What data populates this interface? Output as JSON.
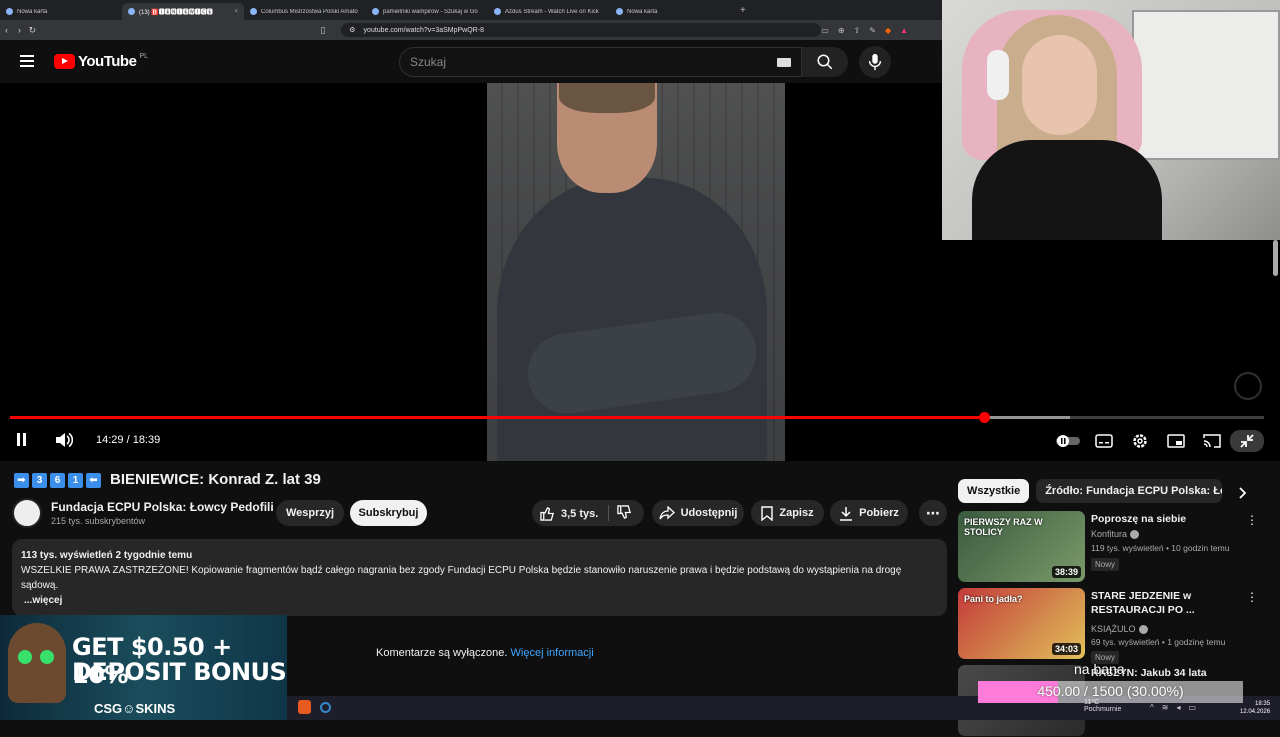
{
  "browser": {
    "tabs": [
      {
        "label": "Nowa karta",
        "active": false
      },
      {
        "label": "(13) 🅱️🅸🅴🅽🅸🅴🆆🅸🅲🅴",
        "active": true
      },
      {
        "label": "Columbus Mistrzostwa Polski Amato",
        "active": false
      },
      {
        "label": "pamietniki wampirow - Szukaj w Go",
        "active": false
      },
      {
        "label": "Azdus Stream - Watch Live on Kick",
        "active": false
      },
      {
        "label": "Nowa karta",
        "active": false
      }
    ],
    "url": "youtube.com/watch?v=3aSMpPwQR-8"
  },
  "header": {
    "logo": "YouTube",
    "region": "PL",
    "search_placeholder": "Szukaj"
  },
  "player": {
    "current_time": "14:29",
    "duration": "18:39",
    "time_display": "14:29 / 18:39",
    "progress_fraction": 0.7766,
    "buffered_fraction": 0.845
  },
  "video": {
    "title_icons": [
      "➡",
      "3",
      "6",
      "1",
      "⬅"
    ],
    "title": "BIENIEWICE: Konrad Z. lat 39",
    "channel": "Fundacja ECPU Polska: Łowcy Pedofili",
    "subscribers": "215 tys. subskrybentów",
    "join_label": "Wesprzyj",
    "subscribe_label": "Subskrybuj",
    "likes": "3,5 tys.",
    "share_label": "Udostępnij",
    "save_label": "Zapisz",
    "download_label": "Pobierz"
  },
  "description": {
    "meta": "113 tys. wyświetleń  2 tygodnie temu",
    "text": "WSZELKIE PRAWA ZASTRZEŻONE! Kopiowanie fragmentów bądź całego nagrania bez zgody Fundacji ECPU Polska będzie stanowiło naruszenie prawa i będzie podstawą do wystąpienia na drogę sądową.",
    "more": "...więcej"
  },
  "comments": {
    "disabled_text": "Komentarze są wyłączone.",
    "link": "Więcej informacji"
  },
  "sidebar": {
    "chips": [
      "Wszystkie",
      "Źródło: Fundacja ECPU Polska: Łowcy"
    ],
    "recommendations": [
      {
        "title": "Poproszę na siebie",
        "channel": "Konfitura",
        "stats": "119 tys. wyświetleń • 10 godzin temu",
        "badge": "Nowy",
        "duration": "38:39",
        "thumb_text": "PIERWSZY RAZ W STOLICY",
        "colors": [
          "#3a5a3e",
          "#7a9a6a"
        ]
      },
      {
        "title": "STARE JEDZENIE w RESTAURACJI PO ...",
        "channel": "KSIĄŻULO",
        "stats": "69 tys. wyświetleń • 1 godzinę temu",
        "badge": "Nowy",
        "duration": "34:03",
        "thumb_text": "Pani to jadła?",
        "colors": [
          "#c43a3a",
          "#e0c15a"
        ]
      },
      {
        "title": "RASZYN: Jakub 34 lata",
        "channel": "",
        "stats": "",
        "badge": "",
        "duration": "",
        "thumb_text": "",
        "colors": [
          "#4a4a4a",
          "#2a2a2a"
        ]
      }
    ]
  },
  "ad": {
    "line1": "GET $0.50 + 10%",
    "line2": "DEPOSIT BONUS",
    "brand": "CSG☺SKINS"
  },
  "taskbar": {
    "weather_temp": "11°C",
    "weather_desc": "Pochmurnie",
    "time": "18:35",
    "date": "12.04.2026"
  },
  "goal": {
    "label": "na bana",
    "current": 450,
    "target": 1500,
    "text": "450.00 / 1500 (30.00%)",
    "fraction": 0.3
  },
  "colors": {
    "accent": "#ff0000",
    "link": "#3ea6ff",
    "goal_fill": "#ff7bd9"
  }
}
